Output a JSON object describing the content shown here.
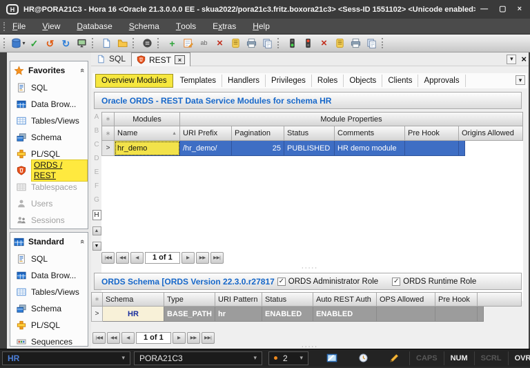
{
  "window": {
    "title": "HR@PORA21C3 - Hora 16   <Oracle 21.3.0.0.0 EE  - skua2022/pora21c3.fritz.boxora21c3>   <Sess-ID 1551102> <Unicode enabled> - R...",
    "app_icon_letter": "H"
  },
  "colors": {
    "highlight_yellow": "#f6e73f",
    "selection_blue": "#3e6ec4",
    "title_blue": "#1667c9",
    "shield_orange": "#e9531d"
  },
  "glyphs": {
    "minimize": "—",
    "maximize": "▢",
    "close": "×",
    "caret_down": "▾",
    "collapse": "«",
    "sort_asc": "▲",
    "marker": "∗",
    "row_pointer": ">",
    "check": "✓",
    "up": "▲",
    "down": "▼",
    "commit": "✓",
    "rollback": "↺",
    "refresh": "↻",
    "add": "+",
    "delete": "×",
    "abc": "ab",
    "pg_first": "|◀◀",
    "pg_back": "◀◀",
    "pg_prev": "◀",
    "pg_next": "▶",
    "pg_fwd": "▶▶",
    "pg_last": "▶▶|",
    "dots": "⋅⋅⋅⋅⋅"
  },
  "menu": {
    "items": [
      {
        "pre": "",
        "key": "F",
        "post": "ile"
      },
      {
        "pre": "",
        "key": "V",
        "post": "iew"
      },
      {
        "pre": "",
        "key": "D",
        "post": "atabase"
      },
      {
        "pre": "",
        "key": "S",
        "post": "chema"
      },
      {
        "pre": "",
        "key": "T",
        "post": "ools"
      },
      {
        "pre": "E",
        "key": "x",
        "post": "tras"
      },
      {
        "pre": "",
        "key": "H",
        "post": "elp"
      }
    ]
  },
  "doc_tabs": {
    "sql": "SQL",
    "rest": "REST"
  },
  "sidebar": {
    "favorites": {
      "title": "Favorites",
      "items": [
        {
          "label": "SQL"
        },
        {
          "label": "Data Brow..."
        },
        {
          "label": "Tables/Views"
        },
        {
          "label": "Schema"
        },
        {
          "label": "PL/SQL"
        },
        {
          "label": "ORDS / REST"
        },
        {
          "label": "Tablespaces"
        },
        {
          "label": "Users"
        },
        {
          "label": "Sessions"
        }
      ]
    },
    "standard": {
      "title": "Standard",
      "items": [
        {
          "label": "SQL"
        },
        {
          "label": "Data Brow..."
        },
        {
          "label": "Tables/Views"
        },
        {
          "label": "Schema"
        },
        {
          "label": "PL/SQL"
        },
        {
          "label": "Sequences"
        }
      ]
    }
  },
  "rest_view": {
    "tabs": [
      {
        "label": "Overview Modules"
      },
      {
        "label": "Templates"
      },
      {
        "label": "Handlers"
      },
      {
        "label": "Privileges"
      },
      {
        "label": "Roles"
      },
      {
        "label": "Objects"
      },
      {
        "label": "Clients"
      },
      {
        "label": "Approvals"
      }
    ],
    "letters": [
      "A",
      "B",
      "C",
      "D",
      "E",
      "F",
      "G",
      "H"
    ],
    "modules": {
      "title": "Oracle ORDS - REST Data Service Modules for schema HR",
      "group_headers": [
        "Modules",
        "Module Properties"
      ],
      "columns": [
        "Name",
        "URI Prefix",
        "Pagination",
        "Status",
        "Comments",
        "Pre Hook",
        "Origins Allowed"
      ],
      "row": {
        "name": "hr_demo",
        "uri_prefix": "/hr_demo/",
        "pagination": "25",
        "status": "PUBLISHED",
        "comments": "HR demo module",
        "pre_hook": "",
        "origins_allowed": ""
      },
      "pager": "1 of 1"
    },
    "schema": {
      "title": "ORDS Schema  [ORDS Version 22.3.0.r27817",
      "admin_role": "ORDS Administrator Role",
      "runtime_role": "ORDS Runtime Role",
      "columns": [
        "Schema",
        "Type",
        "URI Pattern",
        "Status",
        "Auto REST Auth",
        "OPS Allowed",
        "Pre Hook"
      ],
      "row": {
        "schema": "HR",
        "type": "BASE_PATH",
        "uri_pattern": "hr",
        "status": "ENABLED",
        "auto_rest_auth": "ENABLED",
        "ops_allowed": "",
        "pre_hook": ""
      },
      "pager": "1 of 1"
    }
  },
  "statusbar": {
    "schema_combo": "HR",
    "db_combo": "PORA21C3",
    "count_combo": "2",
    "caps": "CAPS",
    "num": "NUM",
    "scrl": "SCRL",
    "ovr": "OVR"
  }
}
